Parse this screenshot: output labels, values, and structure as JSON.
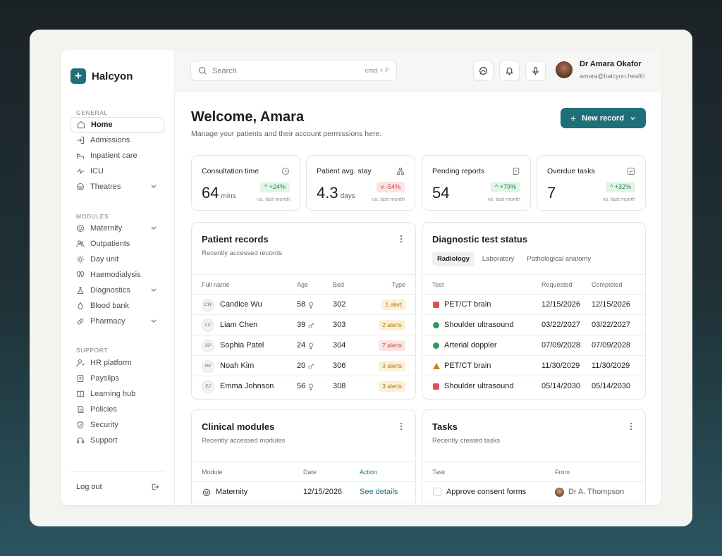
{
  "app": {
    "name": "Halcyon",
    "logo_glyph": "+"
  },
  "sidebar": {
    "sections": [
      {
        "label": "GENERAL",
        "items": [
          {
            "label": "Home",
            "icon": "home-icon",
            "active": true
          },
          {
            "label": "Admissions",
            "icon": "admissions-icon"
          },
          {
            "label": "Inpatient care",
            "icon": "bed-icon"
          },
          {
            "label": "ICU",
            "icon": "pulse-icon"
          },
          {
            "label": "Theatres",
            "icon": "mask-icon",
            "has_children": true
          }
        ]
      },
      {
        "label": "MODULES",
        "items": [
          {
            "label": "Maternity",
            "icon": "baby-icon",
            "has_children": true
          },
          {
            "label": "Outpatients",
            "icon": "users-icon"
          },
          {
            "label": "Day unit",
            "icon": "sun-icon"
          },
          {
            "label": "Haemodialysis",
            "icon": "kidney-icon"
          },
          {
            "label": "Diagnostics",
            "icon": "flask-icon",
            "has_children": true
          },
          {
            "label": "Blood bank",
            "icon": "drop-icon"
          },
          {
            "label": "Pharmacy",
            "icon": "pill-icon",
            "has_children": true
          }
        ]
      },
      {
        "label": "SUPPORT",
        "items": [
          {
            "label": "HR platform",
            "icon": "user-icon"
          },
          {
            "label": "Payslips",
            "icon": "document-icon"
          },
          {
            "label": "Learning hub",
            "icon": "book-icon"
          },
          {
            "label": "Policies",
            "icon": "file-text-icon"
          },
          {
            "label": "Security",
            "icon": "shield-icon"
          },
          {
            "label": "Support",
            "icon": "headset-icon"
          }
        ]
      }
    ],
    "logout_label": "Log out"
  },
  "topbar": {
    "search_placeholder": "Search",
    "search_shortcut": "cmd + F",
    "user_name": "Dr Amara Okafor",
    "user_email": "amara@halcyon.health"
  },
  "header": {
    "title": "Welcome, Amara",
    "subtitle": "Manage your patients and their account permissions here.",
    "new_record_label": "New record"
  },
  "stats": [
    {
      "title": "Consultation time",
      "value": "64",
      "unit": "mins",
      "delta": "+24%",
      "direction": "up",
      "icon": "clock-icon",
      "vs": "vs. last month"
    },
    {
      "title": "Patient avg. stay",
      "value": "4.3",
      "unit": "days",
      "delta": "-54%",
      "direction": "down",
      "icon": "hierarchy-icon",
      "vs": "vs. last month"
    },
    {
      "title": "Pending reports",
      "value": "54",
      "unit": "",
      "delta": "+79%",
      "direction": "up",
      "icon": "report-icon",
      "vs": "vs. last month"
    },
    {
      "title": "Overdue tasks",
      "value": "7",
      "unit": "",
      "delta": "+32%",
      "direction": "up",
      "icon": "check-square-icon",
      "vs": "vs. last month"
    }
  ],
  "patient_records": {
    "title": "Patient records",
    "subtitle": "Recently accessed records",
    "columns": [
      "Full name",
      "Age",
      "Bed",
      "Type"
    ],
    "rows": [
      {
        "initials": "CW",
        "name": "Candice Wu",
        "age": "58",
        "sex": "female",
        "bed": "302",
        "type": "1 alert",
        "severity": "amber"
      },
      {
        "initials": "LC",
        "name": "Liam Chen",
        "age": "39",
        "sex": "male",
        "bed": "303",
        "type": "2 alerts",
        "severity": "amber"
      },
      {
        "initials": "SP",
        "name": "Sophia Patel",
        "age": "24",
        "sex": "female",
        "bed": "304",
        "type": "7 alerts",
        "severity": "red"
      },
      {
        "initials": "NK",
        "name": "Noah Kim",
        "age": "20",
        "sex": "male",
        "bed": "306",
        "type": "3 alerts",
        "severity": "amber"
      },
      {
        "initials": "EJ",
        "name": "Emma Johnson",
        "age": "56",
        "sex": "female",
        "bed": "308",
        "type": "3 alerts",
        "severity": "amber"
      }
    ]
  },
  "diagnostics": {
    "title": "Diagnostic test status",
    "tabs": [
      "Radiology",
      "Laboratory",
      "Pathological anatomy"
    ],
    "active_tab": 0,
    "columns": [
      "Test",
      "Requested",
      "Completed"
    ],
    "rows": [
      {
        "status": "square",
        "color": "#d9534f",
        "test": "PET/CT brain",
        "requested": "12/15/2026",
        "completed": "12/15/2026"
      },
      {
        "status": "circle",
        "color": "#2b9a5a",
        "test": "Shoulder ultrasound",
        "requested": "03/22/2027",
        "completed": "03/22/2027"
      },
      {
        "status": "circle",
        "color": "#2b9a5a",
        "test": "Arterial doppler",
        "requested": "07/09/2028",
        "completed": "07/09/2028"
      },
      {
        "status": "triangle",
        "color": "#c7860f",
        "test": "PET/CT brain",
        "requested": "11/30/2029",
        "completed": "11/30/2029"
      },
      {
        "status": "square",
        "color": "#d9534f",
        "test": "Shoulder ultrasound",
        "requested": "05/14/2030",
        "completed": "05/14/2030"
      }
    ]
  },
  "clinical_modules": {
    "title": "Clinical modules",
    "subtitle": "Recently accessed modules",
    "columns": [
      "Module",
      "Date",
      "Action"
    ],
    "rows": [
      {
        "module": "Maternity",
        "icon": "baby-icon",
        "date": "12/15/2026",
        "action": "See details"
      }
    ]
  },
  "tasks": {
    "title": "Tasks",
    "subtitle": "Recently created tasks",
    "columns": [
      "Task",
      "From"
    ],
    "rows": [
      {
        "task": "Approve consent forms",
        "from": "Dr A. Thompson"
      }
    ]
  },
  "colors": {
    "brand": "#1f6f78",
    "positive": "#2b8a4f",
    "negative": "#c9453a",
    "warning": "#b27b16"
  }
}
